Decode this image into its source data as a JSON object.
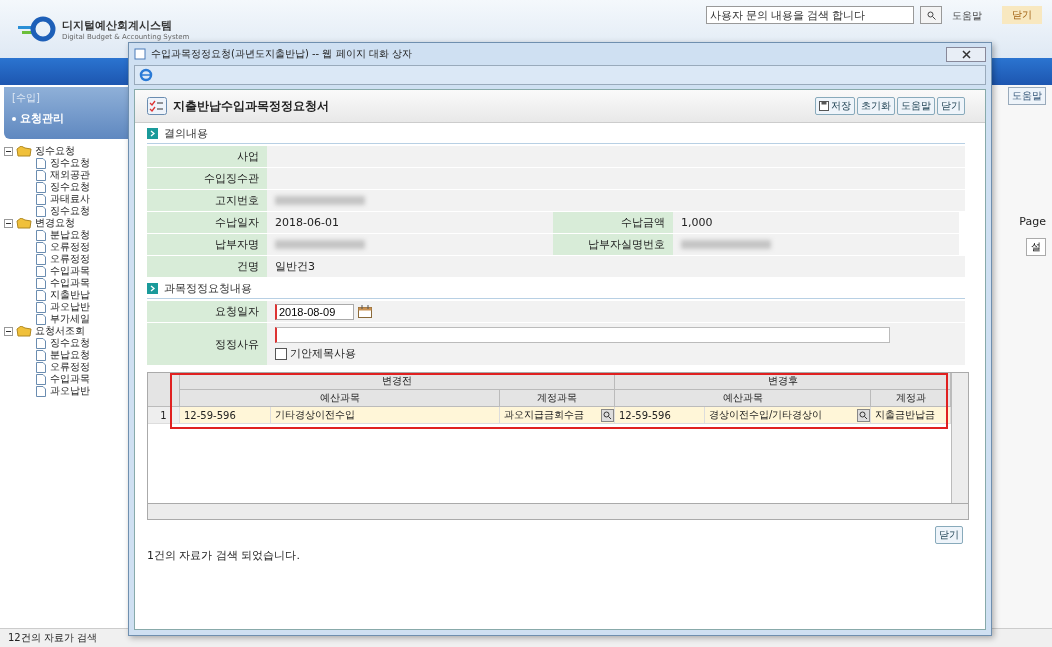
{
  "app": {
    "logo_title": "디지털예산회계시스템",
    "logo_subtitle": "Digital Budget & Accounting System",
    "search": {
      "placeholder": "사용자 문의 내용을 검색 합니다"
    },
    "help_link": "도움말",
    "close_button": "닫기"
  },
  "sidebar": {
    "section": "[수입]",
    "menu": "요청관리",
    "tree": [
      {
        "label": "징수요청",
        "expanded": true,
        "children": [
          {
            "label": "징수요청"
          },
          {
            "label": "재외공관"
          },
          {
            "label": "징수요청"
          },
          {
            "label": "과태료사"
          },
          {
            "label": "징수요청"
          }
        ]
      },
      {
        "label": "변경요청",
        "expanded": true,
        "children": [
          {
            "label": "분납요청"
          },
          {
            "label": "오류정정"
          },
          {
            "label": "오류정정"
          },
          {
            "label": "수입과목"
          },
          {
            "label": "수입과목"
          },
          {
            "label": "지출반납"
          },
          {
            "label": "과오납반"
          },
          {
            "label": "부가세일"
          }
        ]
      },
      {
        "label": "요청서조회",
        "expanded": true,
        "children": [
          {
            "label": "징수요청"
          },
          {
            "label": "분납요청"
          },
          {
            "label": "오류정정"
          },
          {
            "label": "수입과목"
          },
          {
            "label": "과오납반"
          }
        ]
      }
    ]
  },
  "right_panel": {
    "help_button": "도움말",
    "page_label": "Page",
    "button": "설"
  },
  "status_bar": {
    "message": "12건의 자료가 검색"
  },
  "dialog": {
    "title": "수입과목정정요청(과년도지출반납) -- 웹 페이지 대화 상자",
    "form_title": "지출반납수입과목정정요청서",
    "buttons": [
      "저장",
      "초기화",
      "도움말",
      "닫기"
    ],
    "section1": {
      "title": "결의내용",
      "rows": [
        {
          "cells": [
            {
              "label": "사업",
              "redacted": false
            }
          ]
        },
        {
          "cells": [
            {
              "label": "수입징수관",
              "redacted": false
            }
          ]
        },
        {
          "cells": [
            {
              "label": "고지번호",
              "redacted": true
            }
          ]
        },
        {
          "cells": [
            {
              "label": "수납일자",
              "value": "2018-06-01",
              "redacted": false
            },
            {
              "label": "수납금액",
              "value": "1,000",
              "redacted": false
            }
          ]
        },
        {
          "cells": [
            {
              "label": "납부자명",
              "redacted": true
            },
            {
              "label": "납부자실명번호",
              "redacted": true
            }
          ]
        },
        {
          "cells": [
            {
              "label": "건명",
              "value": "일반건3",
              "redacted": false
            }
          ]
        }
      ]
    },
    "section2": {
      "title": "과목정정요청내용",
      "request_date": {
        "label": "요청일자",
        "value": "2018-08-09"
      },
      "reason": {
        "label": "정정사유",
        "checkbox": {
          "label": "기안제목사용",
          "checked": false
        }
      }
    },
    "grid": {
      "groups": [
        "변경전",
        "변경후"
      ],
      "columns": [
        "예산과목",
        "계정과목",
        "예산과목",
        "계정과"
      ],
      "rows": [
        {
          "number": "1",
          "cells": [
            {
              "kind": "budget",
              "code": "12-59-596",
              "name": "기타경상이전수입"
            },
            {
              "kind": "account",
              "name": "과오지급금회수금"
            },
            {
              "kind": "budget",
              "code": "12-59-596",
              "name": "경상이전수입/기타경상이"
            },
            {
              "kind": "account",
              "name": "지출금반납금"
            }
          ]
        }
      ]
    },
    "message": "1건의 자료가 검색 되었습니다.",
    "close_button": "닫기"
  }
}
